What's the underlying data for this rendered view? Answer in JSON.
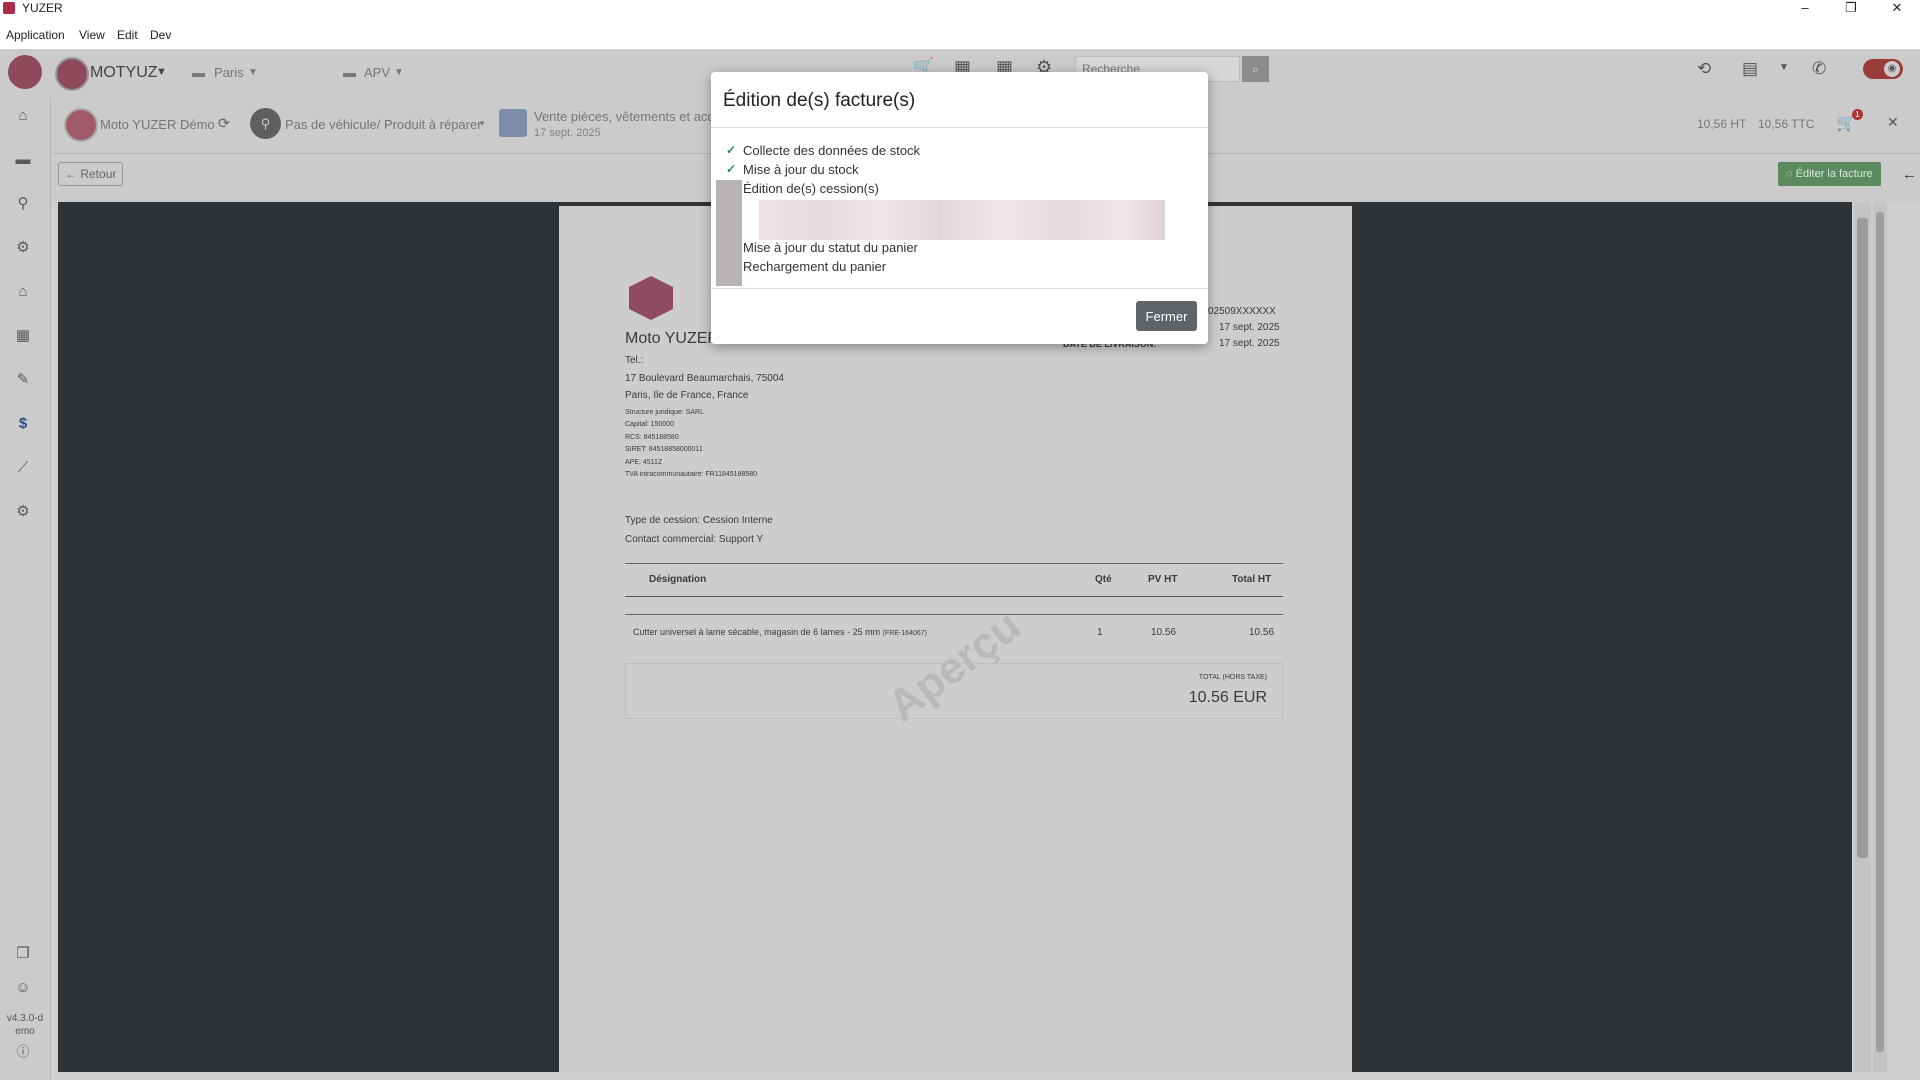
{
  "window": {
    "title": "YUZER",
    "minimize": "–",
    "restore": "❐",
    "close": "✕"
  },
  "menu": [
    "Application",
    "View",
    "Edit",
    "Dev"
  ],
  "topbar": {
    "org": "MOTYUZ",
    "location": "Paris",
    "module": "APV",
    "search_placeholder": "Recherche",
    "search_icon": "search-icon"
  },
  "subbar": {
    "customer": "Moto YUZER Démo",
    "vehicle": "Pas de véhicule/ Produit à réparer",
    "sale_type": "Vente pièces, vêtements et acce",
    "sale_date": "17 sept. 2025",
    "total_ht": "10,56 HT",
    "total_ttc": "10,56 TTC",
    "cart_count": "1"
  },
  "actions": {
    "back": "Retour",
    "edit_invoice": "Éditer la facture"
  },
  "sidebar": {
    "version": "v4.3.0-demo"
  },
  "invoice": {
    "company": "Moto YUZER",
    "tel": "Tel.:",
    "address1": "17 Boulevard Beaumarchais, 75004",
    "address2": "Paris, Ile de France, France",
    "legal": [
      "Structure juridique: SARL",
      "Capital: 150000",
      "RCS: 845188580",
      "SIRET: 84518858000011",
      "APE: 4511Z",
      "TVA intracommunautaire: FR11845188580"
    ],
    "number": "02509XXXXXX",
    "date1": "17 sept. 2025",
    "delivery_label": "DATE DE LIVRAISON:",
    "date2": "17 sept. 2025",
    "cession_type": "Type de cession: Cession Interne",
    "contact": "Contact commercial: Support Y",
    "headers": {
      "designation": "Désignation",
      "qty": "Qté",
      "pv": "PV HT",
      "total": "Total HT"
    },
    "row": {
      "designation": "Cutter universel à lame sécable, magasin de 6 lames - 25 mm",
      "ref": "(FRE-164067)",
      "qty": "1",
      "pv": "10.56",
      "total": "10.56"
    },
    "total_label": "TOTAL (HORS TAXE)",
    "total_value": "10.56 EUR",
    "watermark": "Aperçu"
  },
  "modal": {
    "title": "Édition de(s) facture(s)",
    "steps": [
      {
        "label": "Collecte des données de stock",
        "done": true
      },
      {
        "label": "Mise à jour du stock",
        "done": true
      },
      {
        "label": "Édition de(s) cession(s)",
        "done": false
      },
      {
        "label": "Mise à jour du statut du panier",
        "done": false
      },
      {
        "label": "Rechargement du panier",
        "done": false
      }
    ],
    "close": "Fermer"
  }
}
